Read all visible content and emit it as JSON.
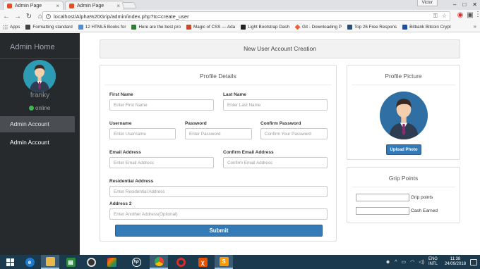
{
  "browser": {
    "tabs": [
      {
        "title": "Admin Page",
        "active": true
      },
      {
        "title": "Admin Page",
        "active": false
      }
    ],
    "user_chip": "Victor",
    "url": "localhost/Alpha%20Grip/admin/index.php?to=create_user",
    "bookmarks": [
      {
        "label": "Apps",
        "icon": "apps-grid-icon",
        "color": "#5f6368"
      },
      {
        "label": "Formatting standard",
        "icon": "doc-icon",
        "color": "#444444"
      },
      {
        "label": "12 HTML5 Books for",
        "icon": "page-icon",
        "color": "#4a90d9"
      },
      {
        "label": "Here are the best pro",
        "icon": "green-square-icon",
        "color": "#2e7d32"
      },
      {
        "label": "Magic of CSS — Ada",
        "icon": "css-icon",
        "color": "#c94b2b"
      },
      {
        "label": "Light Bootstrap Dash",
        "icon": "bootstrap-icon",
        "color": "#222222"
      },
      {
        "label": "Git - Downloading P",
        "icon": "git-icon",
        "color": "#e8643a"
      },
      {
        "label": "Top 26 Free Respons",
        "icon": "template-icon",
        "color": "#2a4d7a"
      },
      {
        "label": "Bitbank Bitcoin Crypt",
        "icon": "bitbank-icon",
        "color": "#1e4fa3"
      }
    ]
  },
  "sidebar": {
    "title": "Admin Home",
    "username": "franky",
    "status": "online",
    "items": [
      {
        "label": "Admin Account",
        "active": true
      },
      {
        "label": "Admin Account",
        "active": false
      }
    ]
  },
  "main": {
    "header": "New User Account Creation",
    "details": {
      "title": "Profile Details",
      "fields": {
        "first_name": {
          "label": "First Name",
          "placeholder": "Enter First Name"
        },
        "last_name": {
          "label": "Last Name",
          "placeholder": "Enter Last Name"
        },
        "username": {
          "label": "Username",
          "placeholder": "Enter Username"
        },
        "password": {
          "label": "Password",
          "placeholder": "Enter Password"
        },
        "confirm_password": {
          "label": "Confirm Password",
          "placeholder": "Confirm Your Password"
        },
        "email": {
          "label": "Email Address",
          "placeholder": "Enter Email Address"
        },
        "confirm_email": {
          "label": "Confirm Email Address",
          "placeholder": "Confirm Email Address"
        },
        "residential": {
          "label": "Residential Address",
          "placeholder": "Enter Residential Address"
        },
        "address2": {
          "label": "Address 2",
          "placeholder": "Enter Another Address(Optional)"
        }
      },
      "submit_label": "Submit"
    },
    "picture": {
      "title": "Profile Picture",
      "upload_label": "Upload Photo"
    },
    "grip": {
      "title": "Grip Points",
      "fields": [
        {
          "label": "Grip points",
          "value": ""
        },
        {
          "label": "Cash Earned",
          "value": ""
        }
      ]
    }
  },
  "taskbar": {
    "apps": [
      {
        "icon": "edge-icon",
        "color": "#1e7bd2"
      },
      {
        "icon": "file-explorer-icon",
        "color": "#e8b94a"
      },
      {
        "icon": "store-icon",
        "color": "#2a8a3f"
      },
      {
        "icon": "camera-app-icon",
        "color": "#333333"
      },
      {
        "icon": "photos-icon",
        "color": "#c2185b"
      },
      {
        "icon": "hp-icon",
        "color": "#1b3a4d"
      },
      {
        "icon": "chrome-icon",
        "color": "#34a853"
      },
      {
        "icon": "opera-icon",
        "color": "#d32f2f"
      },
      {
        "icon": "xampp-icon",
        "color": "#e65100"
      },
      {
        "icon": "sublime-icon",
        "color": "#ff9800"
      }
    ],
    "language": [
      "ENG",
      "INTL"
    ],
    "time": "11:38",
    "date": "24/09/2018"
  },
  "colors": {
    "sidebar_bg": "#272a2d",
    "accent_blue": "#337ab7",
    "online_green": "#3fb74f",
    "taskbar_bg": "#1b3a4d"
  }
}
